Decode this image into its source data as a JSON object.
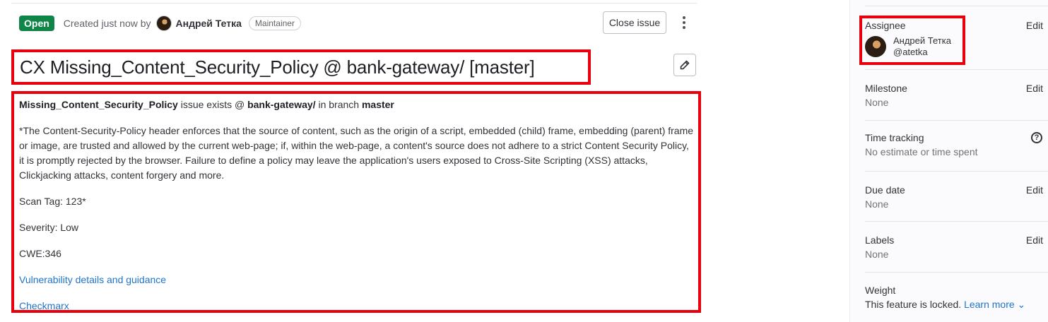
{
  "header": {
    "status": "Open",
    "created_text": "Created just now by",
    "author_name": "Андрей Тетка",
    "author_role": "Maintainer",
    "close_button": "Close issue"
  },
  "issue": {
    "title": "CX Missing_Content_Security_Policy @ bank-gateway/ [master]"
  },
  "description": {
    "line1_vuln": "Missing_Content_Security_Policy",
    "line1_mid": " issue exists @ ",
    "line1_project": "bank-gateway/",
    "line1_branch_text": " in branch ",
    "line1_branch": "master",
    "paragraph": "*The Content-Security-Policy header enforces that the source of content, such as the origin of a script, embedded (child) frame, embedding (parent) frame or image, are trusted and allowed by the current web-page; if, within the web-page, a content's source does not adhere to a strict Content Security Policy, it is promptly rejected by the browser. Failure to define a policy may leave the application's users exposed to Cross-Site Scripting (XSS) attacks, Clickjacking attacks, content forgery and more.",
    "scan_tag": "Scan Tag: 123*",
    "severity": "Severity: Low",
    "cwe": "CWE:346",
    "link_guidance": "Vulnerability details and guidance",
    "link_checkmarx": "Checkmarx"
  },
  "sidebar": {
    "assignee": {
      "label": "Assignee",
      "edit": "Edit",
      "name": "Андрей Тетка",
      "username": "@atetka"
    },
    "milestone": {
      "label": "Milestone",
      "edit": "Edit",
      "value": "None"
    },
    "time_tracking": {
      "label": "Time tracking",
      "value": "No estimate or time spent",
      "help_glyph": "?"
    },
    "due_date": {
      "label": "Due date",
      "edit": "Edit",
      "value": "None"
    },
    "labels": {
      "label": "Labels",
      "edit": "Edit",
      "value": "None"
    },
    "weight": {
      "label": "Weight",
      "value": "This feature is locked.",
      "learn_more": "Learn more",
      "chevron": "⌄"
    }
  },
  "colors": {
    "open_badge": "#108548",
    "highlight_border": "#e8000c",
    "link": "#1f75cb"
  }
}
